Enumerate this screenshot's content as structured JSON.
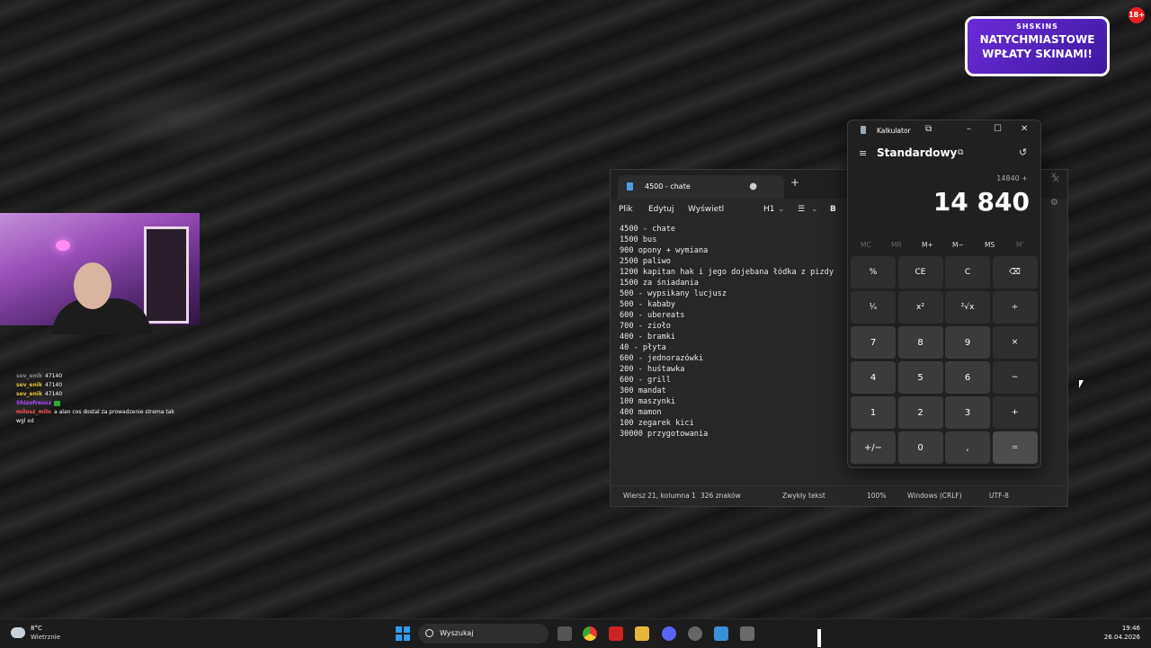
{
  "overlay": {
    "promo_brand": "SHSKINS",
    "promo_line1": "NATYCHMIASTOWE",
    "promo_line2": "WPŁATY SKINAMI!",
    "promo_badge": "18+",
    "chat": [
      {
        "user": "sev_enik",
        "text": "47140",
        "color": "#888888"
      },
      {
        "user": "sev_enik",
        "text": "47140",
        "color": "#e8c33a"
      },
      {
        "user": "sev_enik",
        "text": "47140",
        "color": "#e8c33a"
      },
      {
        "user": "Shizofreusz",
        "text": "",
        "color": "#b04cff"
      },
      {
        "user": "milosz_milo",
        "text": "a alan cos dostal za prowadzenie strema tak wgl xd",
        "color": "#ff5555"
      }
    ]
  },
  "notepad": {
    "tab_title": "4500 - chate",
    "menu": {
      "file": "Plik",
      "edit": "Edytuj",
      "view": "Wyświetl",
      "heading": "H1",
      "bold": "B"
    },
    "lines": [
      "4500 - chate",
      "1500 bus",
      "900 opony + wymiana",
      "2500 paliwo",
      "1200 kapitan hak i jego dojebana łódka z pizdy",
      "1500 za śniadania",
      "500 - wypsikany lucjusz",
      "500 - kababy",
      "600 - ubereats",
      "700 - zioło",
      "400 - bramki",
      "40 - płyta",
      "600 - jednorazówki",
      "200 - huśtawka",
      "600 - grill",
      "300 mandat",
      "100 maszynki",
      "400 mamon",
      "100 zegarek kici",
      "30000 przygotowania"
    ],
    "status": {
      "position": "Wiersz 21, kolumna 1",
      "chars": "326 znaków",
      "format": "Zwykły tekst",
      "zoom": "100%",
      "line_endings": "Windows (CRLF)",
      "encoding": "UTF-8"
    }
  },
  "calculator": {
    "title": "Kalkulator",
    "mode": "Standardowy",
    "expression": "14840 +",
    "display": "14 840",
    "memory": [
      "MC",
      "MR",
      "M+",
      "M−",
      "MS",
      "M˅"
    ],
    "keys": [
      "%",
      "CE",
      "C",
      "⌫",
      "¹⁄ₓ",
      "x²",
      "²√x",
      "÷",
      "7",
      "8",
      "9",
      "×",
      "4",
      "5",
      "6",
      "−",
      "1",
      "2",
      "3",
      "+",
      "+/−",
      "0",
      ",",
      "="
    ]
  },
  "taskbar": {
    "temp": "8°C",
    "weather": "Wietrznie",
    "search_placeholder": "Wyszukaj",
    "time": "19:46",
    "date": "26.04.2026"
  }
}
